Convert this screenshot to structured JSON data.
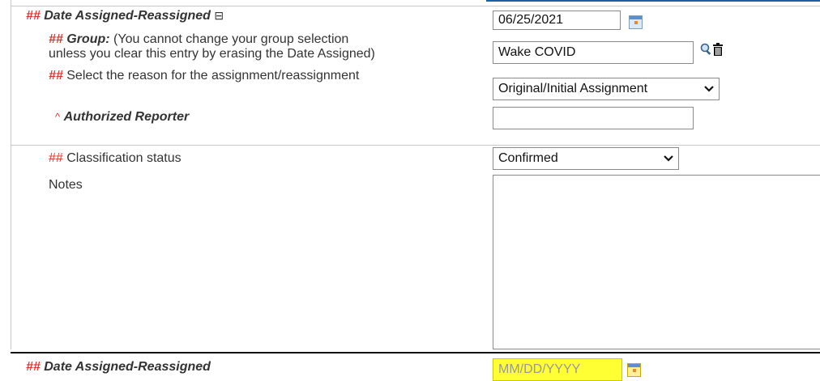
{
  "section1": {
    "date_row": {
      "marker": "##",
      "label": "Date Assigned-Reassigned",
      "collapse_glyph": "⊟",
      "value": "06/25/2021"
    },
    "group_row": {
      "marker": "##",
      "label": "Group:",
      "help_line1": "(You cannot change your group selection",
      "help_line2": "unless you clear this entry by erasing the Date Assigned)",
      "value": "Wake COVID"
    },
    "reason_row": {
      "marker": "##",
      "label": "Select the reason for the assignment/reassignment",
      "selected": "Original/Initial Assignment"
    },
    "reporter_row": {
      "marker": "^",
      "label": "Authorized Reporter",
      "value": ""
    },
    "classification_row": {
      "marker": "##",
      "label": "Classification status",
      "selected": "Confirmed"
    },
    "notes_row": {
      "label": "Notes",
      "value": ""
    }
  },
  "section2": {
    "date_row": {
      "marker": "##",
      "label": "Date Assigned-Reassigned",
      "placeholder": "MM/DD/YYYY"
    }
  },
  "colors": {
    "marker": "#e0312b",
    "highlight_input": "#ffff33",
    "top_rule": "#1f5fa8"
  },
  "icons": {
    "calendar": "calendar-icon",
    "search": "search-icon",
    "delete": "trash-icon",
    "collapse": "collapse-icon",
    "dropdown": "chevron-down-icon"
  }
}
